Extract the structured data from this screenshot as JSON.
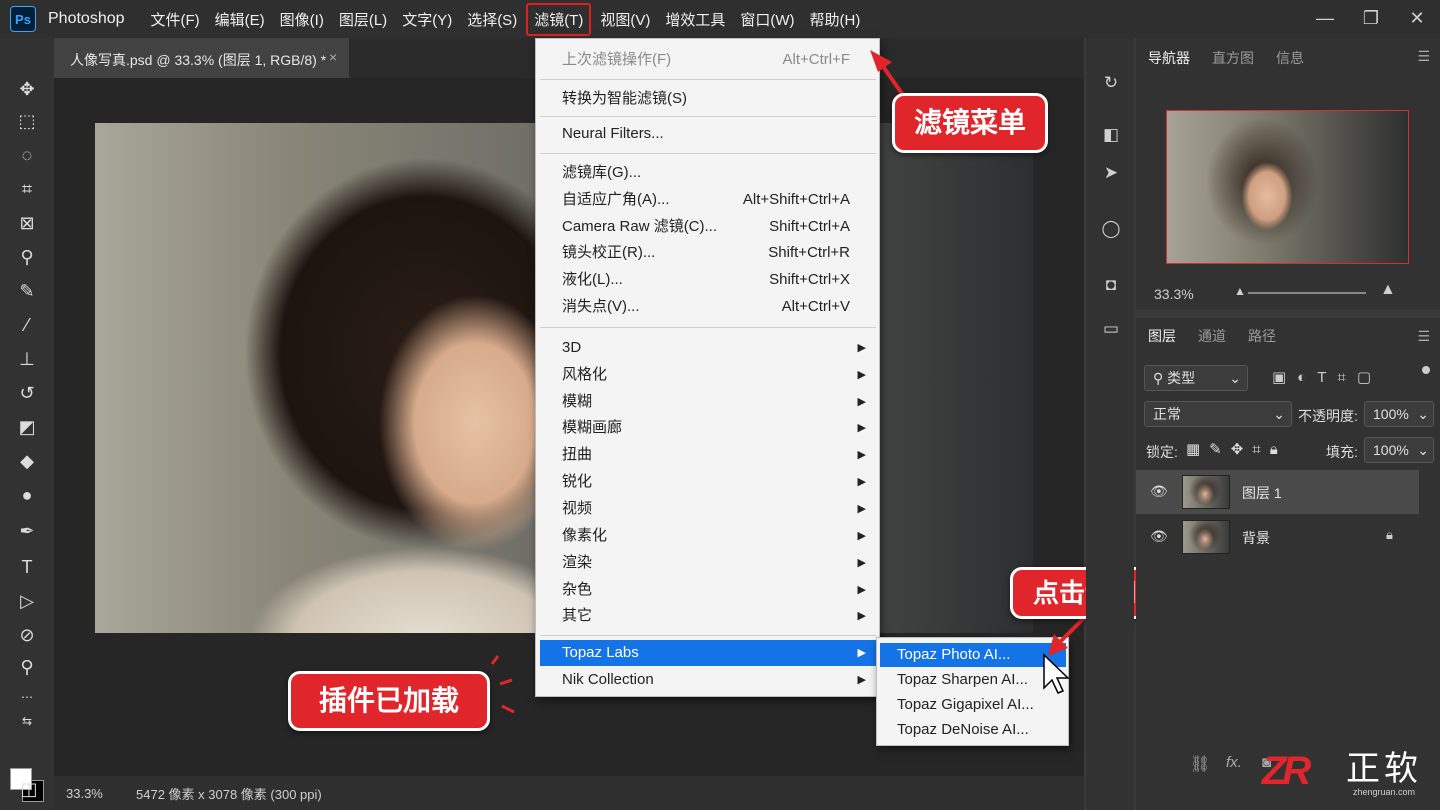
{
  "app": {
    "logo": "Ps",
    "name": "Photoshop"
  },
  "menubar": [
    "文件(F)",
    "编辑(E)",
    "图像(I)",
    "图层(L)",
    "文字(Y)",
    "选择(S)",
    "滤镜(T)",
    "视图(V)",
    "增效工具",
    "窗口(W)",
    "帮助(H)"
  ],
  "window_controls": {
    "minimize": "—",
    "restore": "❐",
    "close": "✕"
  },
  "document": {
    "tab_title": "人像写真.psd @ 33.3% (图层 1, RGB/8) *",
    "close": "×",
    "zoom": "33.3%",
    "info": "5472 像素 x 3078 像素 (300 ppi)"
  },
  "filter_menu": {
    "last_filter": {
      "label": "上次滤镜操作(F)",
      "shortcut": "Alt+Ctrl+F"
    },
    "smart_filter": "转换为智能滤镜(S)",
    "neural": "Neural Filters...",
    "gallery": "滤镜库(G)...",
    "adaptive_wide": {
      "label": "自适应广角(A)...",
      "shortcut": "Alt+Shift+Ctrl+A"
    },
    "camera_raw": {
      "label": "Camera Raw 滤镜(C)...",
      "shortcut": "Shift+Ctrl+A"
    },
    "lens_correction": {
      "label": "镜头校正(R)...",
      "shortcut": "Shift+Ctrl+R"
    },
    "liquify": {
      "label": "液化(L)...",
      "shortcut": "Shift+Ctrl+X"
    },
    "vanishing_point": {
      "label": "消失点(V)...",
      "shortcut": "Alt+Ctrl+V"
    },
    "submenus": [
      "3D",
      "风格化",
      "模糊",
      "模糊画廊",
      "扭曲",
      "锐化",
      "视频",
      "像素化",
      "渲染",
      "杂色",
      "其它"
    ],
    "plugins": [
      "Topaz Labs",
      "Nik Collection"
    ]
  },
  "topaz_submenu": [
    "Topaz Photo AI...",
    "Topaz Sharpen AI...",
    "Topaz Gigapixel AI...",
    "Topaz DeNoise AI..."
  ],
  "callouts": {
    "filter_menu": "滤镜菜单",
    "click_invoke": "点击调用",
    "plugin_loaded": "插件已加载"
  },
  "navigator": {
    "tabs": [
      "导航器",
      "直方图",
      "信息"
    ],
    "zoom": "33.3%"
  },
  "layers_panel": {
    "tabs": [
      "图层",
      "通道",
      "路径"
    ],
    "filter_kind": "类型",
    "blend_mode": "正常",
    "opacity_label": "不透明度:",
    "opacity": "100%",
    "lock_label": "锁定:",
    "fill_label": "填充:",
    "fill": "100%",
    "layers": [
      {
        "name": "图层 1",
        "selected": true
      },
      {
        "name": "背景",
        "locked": true
      }
    ],
    "footer_fx": "fx."
  },
  "watermark": {
    "logo": "ZR",
    "name": "正软",
    "url": "zhengruan.com"
  }
}
